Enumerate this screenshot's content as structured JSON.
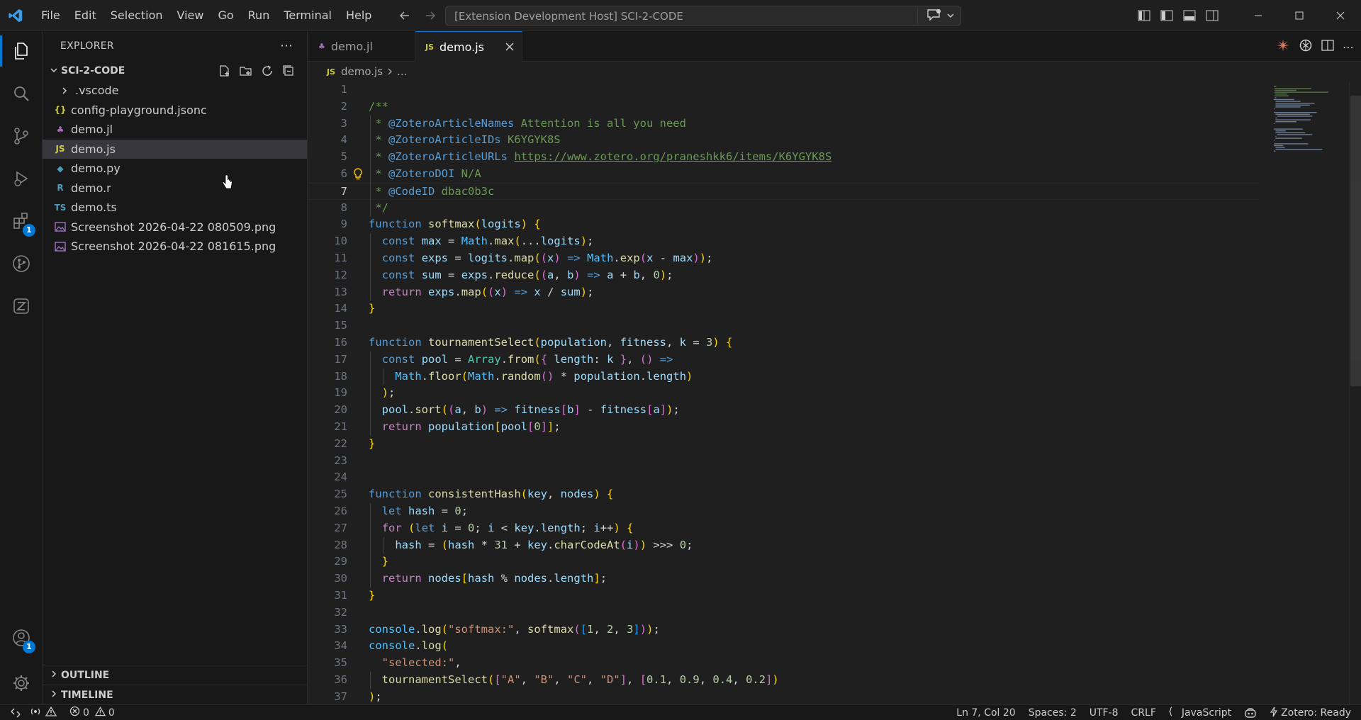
{
  "titlebar": {
    "menu": [
      "File",
      "Edit",
      "Selection",
      "View",
      "Go",
      "Run",
      "Terminal",
      "Help"
    ],
    "command_center": "[Extension Development Host] SCI-2-CODE"
  },
  "activitybar": {
    "items": [
      {
        "name": "explorer-icon",
        "active": true
      },
      {
        "name": "search-icon"
      },
      {
        "name": "source-control-icon"
      },
      {
        "name": "run-debug-icon"
      },
      {
        "name": "extensions-icon",
        "badge": "1"
      },
      {
        "name": "git-graph-icon"
      },
      {
        "name": "zotero-icon"
      }
    ],
    "accounts_badge": "1"
  },
  "sidebar": {
    "title": "EXPLORER",
    "folder": "SCI-2-CODE",
    "files": [
      {
        "label": ".vscode",
        "icon": "chevron-right",
        "type": "folder"
      },
      {
        "label": "config-playground.jsonc",
        "icon": "{}",
        "color": "#cbcb41"
      },
      {
        "label": "demo.jl",
        "icon": "jl",
        "color": "#a270ba"
      },
      {
        "label": "demo.js",
        "icon": "JS",
        "color": "#cbcb41",
        "selected": true
      },
      {
        "label": "demo.py",
        "icon": "py",
        "color": "#519aba"
      },
      {
        "label": "demo.r",
        "icon": "R",
        "color": "#519aba"
      },
      {
        "label": "demo.ts",
        "icon": "TS",
        "color": "#519aba"
      },
      {
        "label": "Screenshot 2026-04-22 080509.png",
        "icon": "img",
        "color": "#a074c4"
      },
      {
        "label": "Screenshot 2026-04-22 081615.png",
        "icon": "img",
        "color": "#a074c4"
      }
    ],
    "outline": "OUTLINE",
    "timeline": "TIMELINE"
  },
  "tabs": [
    {
      "label": "demo.jl",
      "icon": "jl",
      "color": "#a270ba"
    },
    {
      "label": "demo.js",
      "icon": "JS",
      "color": "#cbcb41",
      "active": true
    }
  ],
  "breadcrumb": {
    "file": "demo.js",
    "rest": "..."
  },
  "code": {
    "current_line": 7,
    "lines": [
      "",
      "/**",
      " * @ZoteroArticleNames Attention is all you need",
      " * @ZoteroArticleIDs K6YGYK8S",
      " * @ZoteroArticleURLs https://www.zotero.org/praneshkk6/items/K6YGYK8S",
      " * @ZoteroDOI N/A",
      " * @CodeID dbac0b3c",
      " */",
      "function softmax(logits) {",
      "  const max = Math.max(...logits);",
      "  const exps = logits.map((x) => Math.exp(x - max));",
      "  const sum = exps.reduce((a, b) => a + b, 0);",
      "  return exps.map((x) => x / sum);",
      "}",
      "",
      "function tournamentSelect(population, fitness, k = 3) {",
      "  const pool = Array.from({ length: k }, () =>",
      "    Math.floor(Math.random() * population.length)",
      "  );",
      "  pool.sort((a, b) => fitness[b] - fitness[a]);",
      "  return population[pool[0]];",
      "}",
      "",
      "",
      "function consistentHash(key, nodes) {",
      "  let hash = 0;",
      "  for (let i = 0; i < key.length; i++) {",
      "    hash = (hash * 31 + key.charCodeAt(i)) >>> 0;",
      "  }",
      "  return nodes[hash % nodes.length];",
      "}",
      "",
      "console.log(\"softmax:\", softmax([1, 2, 3]));",
      "console.log(",
      "  \"selected:\",",
      "  tournamentSelect([\"A\", \"B\", \"C\", \"D\"], [0.1, 0.9, 0.4, 0.2])",
      ");"
    ]
  },
  "statusbar": {
    "errors": "0",
    "warnings": "0",
    "position": "Ln 7, Col 20",
    "spaces": "Spaces: 2",
    "encoding": "UTF-8",
    "eol": "CRLF",
    "language": "JavaScript",
    "zotero": "Zotero: Ready"
  },
  "colors": {
    "accent": "#0078d4",
    "editor_bg": "#1f1f1f",
    "sidebar_bg": "#181818"
  }
}
